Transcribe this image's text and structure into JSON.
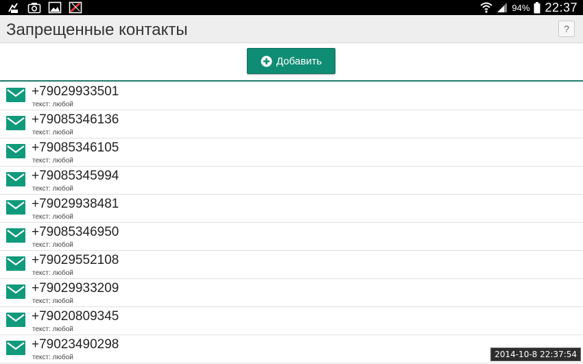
{
  "status_bar": {
    "icons": [
      "usb-debug-icon",
      "screenshot-icon",
      "gallery-icon",
      "blocked-icon"
    ],
    "battery": "94%",
    "time": "22:37"
  },
  "header": {
    "title": "Запрещенные контакты",
    "help": "?"
  },
  "toolbar": {
    "add_label": "Добавить"
  },
  "contacts": [
    {
      "phone": "+79029933501",
      "text": "текст: любой"
    },
    {
      "phone": "+79085346136",
      "text": "текст: любой"
    },
    {
      "phone": "+79085346105",
      "text": "текст: любой"
    },
    {
      "phone": "+79085345994",
      "text": "текст: любой"
    },
    {
      "phone": "+79029938481",
      "text": "текст: любой"
    },
    {
      "phone": "+79085346950",
      "text": "текст: любой"
    },
    {
      "phone": "+79029552108",
      "text": "текст: любой"
    },
    {
      "phone": "+79029933209",
      "text": "текст: любой"
    },
    {
      "phone": "+79020809345",
      "text": "текст: любой"
    },
    {
      "phone": "+79023490298",
      "text": "текст: любой"
    }
  ],
  "overlay": {
    "timestamp": "2014-10-8 22:37:54"
  },
  "colors": {
    "accent": "#0f8d74",
    "icon": "#109a7c"
  }
}
